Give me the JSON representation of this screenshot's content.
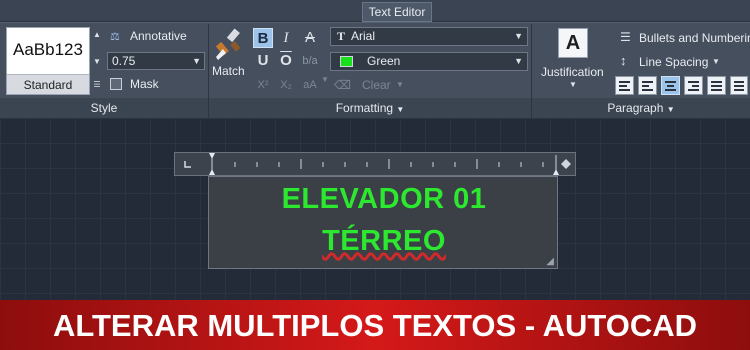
{
  "context_tab": {
    "label": "Text Editor"
  },
  "style_panel": {
    "preview_text": "AaBb123",
    "style_name": "Standard",
    "annotative_label": "Annotative",
    "text_height": "0.75",
    "mask_label": "Mask",
    "panel_title": "Style"
  },
  "formatting_panel": {
    "match_label": "Match",
    "bold_glyph": "B",
    "italic_glyph": "I",
    "strike_glyph": "A",
    "underline_glyph": "U",
    "overline_glyph": "O",
    "font_glyph": "T",
    "font_name": "Arial",
    "color_name": "Green",
    "color_swatch": "#19e01c",
    "clear_label": "Clear",
    "panel_title": "Formatting"
  },
  "paragraph_panel": {
    "justification_glyph": "A",
    "justification_label": "Justification",
    "bullets_label": "Bullets and Numbering",
    "line_spacing_label": "Line Spacing",
    "panel_title": "Paragraph"
  },
  "editor": {
    "line1": "ELEVADOR 01",
    "line2": "TÉRREO"
  },
  "banner": {
    "text": "ALTERAR MULTIPLOS TEXTOS - AUTOCAD"
  },
  "colors": {
    "text_green": "#2ce92f",
    "banner_red": "#d51919",
    "ribbon": "#454f5e"
  }
}
